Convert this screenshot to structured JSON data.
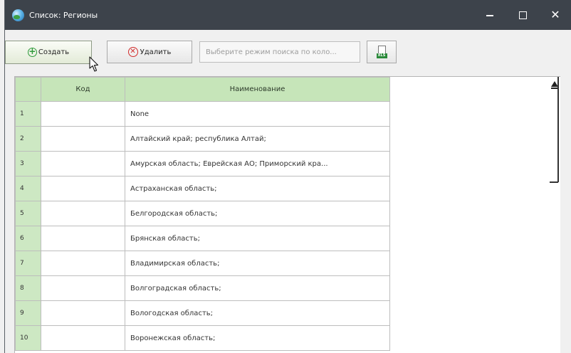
{
  "window": {
    "title": "Список: Регионы",
    "controls": {
      "minimize": "–",
      "maximize": "□",
      "close": "✕"
    }
  },
  "toolbar": {
    "create_label": "Создать",
    "delete_label": "Удалить",
    "search_placeholder": "Выберите режим поиска по коло...",
    "export_icon_text": "XLS"
  },
  "table": {
    "columns": [
      "",
      "Код",
      "Наименование"
    ],
    "rows": [
      {
        "num": "1",
        "code": "",
        "name": "None"
      },
      {
        "num": "2",
        "code": "",
        "name": "Алтайский край; республика Алтай;"
      },
      {
        "num": "3",
        "code": "",
        "name": "Амурская область; Еврейская АО; Приморский кра..."
      },
      {
        "num": "4",
        "code": "",
        "name": "Астраханская область;"
      },
      {
        "num": "5",
        "code": "",
        "name": "Белгородская область;"
      },
      {
        "num": "6",
        "code": "",
        "name": "Брянская область;"
      },
      {
        "num": "7",
        "code": "",
        "name": "Владимирская область;"
      },
      {
        "num": "8",
        "code": "",
        "name": "Волгоградская область;"
      },
      {
        "num": "9",
        "code": "",
        "name": "Вологодская область;"
      },
      {
        "num": "10",
        "code": "",
        "name": "Воронежская область;"
      }
    ]
  },
  "colors": {
    "titlebar": "#3d434b",
    "header_green": "#c6e5b9",
    "row_num_green": "#cde8c3"
  }
}
